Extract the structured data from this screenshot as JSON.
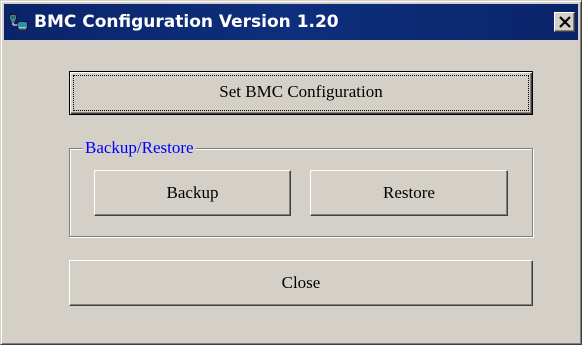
{
  "window": {
    "title": "BMC Configuration Version 1.20",
    "title_icon": "network-computer-icon",
    "close_glyph": "X"
  },
  "buttons": {
    "set_bmc": "Set BMC Configuration",
    "backup": "Backup",
    "restore": "Restore",
    "close": "Close"
  },
  "group": {
    "legend": "Backup/Restore"
  },
  "colors": {
    "title_bar": "#0a246a",
    "face": "#d4d0c8",
    "group_legend": "#0000ff"
  }
}
